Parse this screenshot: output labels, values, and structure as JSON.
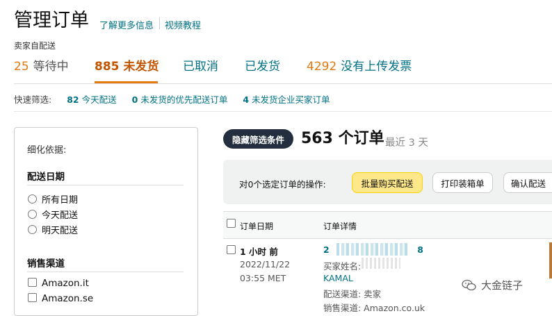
{
  "header": {
    "title": "管理订单",
    "learn_more": "了解更多信息",
    "video": "视频教程",
    "seller_fulfilled": "卖家自配送"
  },
  "tabs": [
    {
      "num": "25",
      "label": "等待中"
    },
    {
      "num": "885",
      "label": "未发货"
    },
    {
      "num": "",
      "label": "已取消"
    },
    {
      "num": "",
      "label": "已发货"
    },
    {
      "num": "4292",
      "label": "没有上传发票"
    }
  ],
  "quick_filter": {
    "label": "快速筛选:",
    "items": [
      {
        "count": "82",
        "label": "今天配送"
      },
      {
        "count": "0",
        "label": "未发货的优先配送订单"
      },
      {
        "count": "4",
        "label": "未发货企业买家订单"
      }
    ]
  },
  "refine": {
    "title": "细化依据:",
    "ship_date_title": "配送日期",
    "ship_date_options": [
      "所有日期",
      "今天配送",
      "明天配送"
    ],
    "channel_title": "销售渠道",
    "channel_options": [
      "Amazon.it",
      "Amazon.se"
    ]
  },
  "orders": {
    "hide_filters": "隐藏筛选条件",
    "count_text": "563 个订单",
    "recent_text": "最近 3 天",
    "bulk_label": "对0个选定订单的操作:",
    "buttons": {
      "buy_shipping": "批量购买配送",
      "print_packing": "打印装箱单",
      "confirm_ship": "确认配送"
    },
    "columns": {
      "order_date": "订单日期",
      "order_details": "订单详情"
    },
    "row": {
      "when": "1 小时 前",
      "date": "2022/11/22",
      "time": "03:55 MET",
      "id_visible_start": "2",
      "id_visible_end": "8",
      "buyer_label": "买家姓名:",
      "buyer_name": "KAMAL",
      "fulfilment": "配送渠道: 卖家",
      "channel": "销售渠道: Amazon.co.uk"
    }
  },
  "watermark": "大金链子",
  "colors": {
    "link": "#007185",
    "tab_active": "#c45500",
    "accent_orange": "#e47911",
    "primary_btn": "#ffe88a",
    "dark_btn": "#232f3e"
  }
}
